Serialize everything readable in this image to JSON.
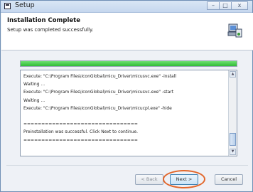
{
  "window": {
    "title": "Setup",
    "controls": [
      "–",
      "□",
      "x"
    ]
  },
  "header": {
    "title": "Installation Complete",
    "subtitle": "Setup was completed successfully.",
    "icon": "installer-computer-icon"
  },
  "progress": {
    "value": 1.0,
    "color": "#2fbc36"
  },
  "log": {
    "lines": [
      "Execute:  \"C:\\Program Files\\IconGlobal\\micu_Driver\\micusvc.exe\" -install",
      "Waiting ...",
      "Execute:  \"C:\\Program Files\\IconGlobal\\micu_Driver\\micusvc.exe\" -start",
      "Waiting ...",
      "Execute:  \"C:\\Program Files\\IconGlobal\\micu_Driver\\micucpl.exe\" -hide",
      "",
      "================================",
      "Preinstallation was successful. Click Next to continue.",
      "================================"
    ]
  },
  "buttons": {
    "back": "< Back",
    "next": "Next >",
    "cancel": "Cancel"
  },
  "highlight_color": "#e2662a"
}
